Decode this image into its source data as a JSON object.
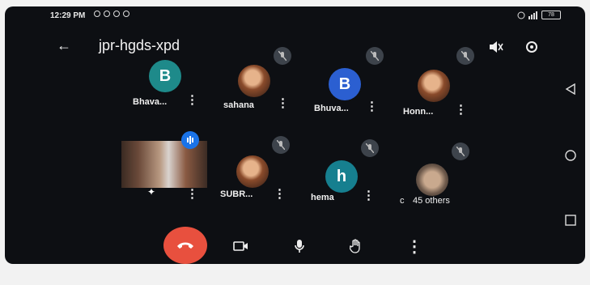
{
  "status": {
    "time": "12:29 PM",
    "battery": "78"
  },
  "header": {
    "back_icon": "arrow-left-icon",
    "meeting_code": "jpr-hgds-xpd",
    "speaker_icon": "speaker-off-icon",
    "camera_switch_icon": "switch-camera-icon"
  },
  "participants": [
    {
      "name": "Bhava...",
      "initial": "B",
      "color": "#1e8a8a"
    },
    {
      "name": "sahana",
      "initial": "",
      "color": ""
    },
    {
      "name": "Bhuva...",
      "initial": "B",
      "color": "#2b5fd1"
    },
    {
      "name": "Honn...",
      "initial": "",
      "color": ""
    },
    {
      "name": "SUBR...",
      "initial": "",
      "color": ""
    },
    {
      "name": "hema",
      "initial": "h",
      "color": "#167f8f"
    },
    {
      "name": "45 others",
      "initial": "",
      "color": ""
    }
  ],
  "self_tile": {
    "initial": "c"
  },
  "controls": {
    "end_call_icon": "phone-hangup-icon",
    "camera_icon": "camera-off-icon",
    "mic_icon": "mic-icon",
    "raise_hand_icon": "raise-hand-icon",
    "more_icon": "more-vertical-icon"
  },
  "nav": {
    "back_icon": "nav-back-icon",
    "home_icon": "nav-home-icon",
    "recents_icon": "nav-recents-icon"
  },
  "colors": {
    "background": "#0d0f13",
    "end_call": "#e8503e",
    "speaking": "#1a73e8"
  }
}
